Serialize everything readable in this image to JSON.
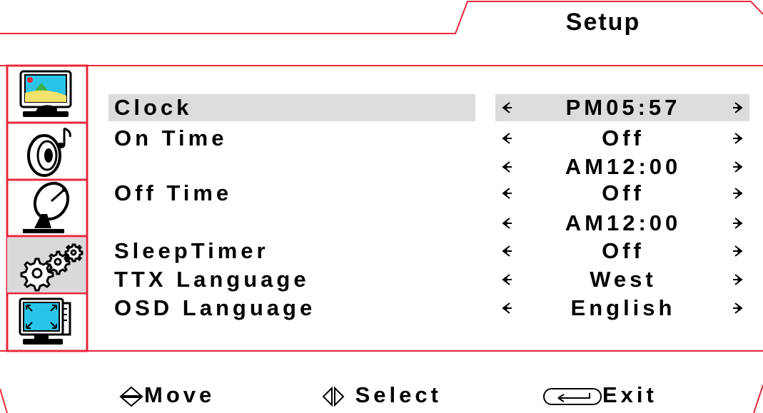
{
  "header": {
    "title": "Setup"
  },
  "sidebar": {
    "items": [
      {
        "name": "picture",
        "icon": "monitor-picture-icon",
        "selected": false
      },
      {
        "name": "sound",
        "icon": "speaker-music-icon",
        "selected": false
      },
      {
        "name": "tv",
        "icon": "satellite-dish-icon",
        "selected": false
      },
      {
        "name": "setup",
        "icon": "gears-icon",
        "selected": true
      },
      {
        "name": "screen",
        "icon": "monitor-resize-icon",
        "selected": false
      }
    ]
  },
  "menu": {
    "rows": [
      {
        "label": "Clock",
        "value": "PM05:57",
        "selected": true
      },
      {
        "label": "On Time",
        "value": "Off",
        "selected": false
      },
      {
        "label": "",
        "value": "AM12:00",
        "selected": false
      },
      {
        "label": "Off Time",
        "value": "Off",
        "selected": false
      },
      {
        "label": "",
        "value": "AM12:00",
        "selected": false
      },
      {
        "label": "SleepTimer",
        "value": "Off",
        "selected": false
      },
      {
        "label": "TTX Language",
        "value": "West",
        "selected": false
      },
      {
        "label": "OSD Language",
        "value": "English",
        "selected": false
      }
    ]
  },
  "footer": {
    "move_label": "Move",
    "select_label": "Select",
    "exit_label": "Exit"
  },
  "colors": {
    "frame": "#e8283a",
    "highlight": "#dcdcdc",
    "sidebar_selected": "#d9d9d9",
    "screen": "#29c4e8"
  }
}
